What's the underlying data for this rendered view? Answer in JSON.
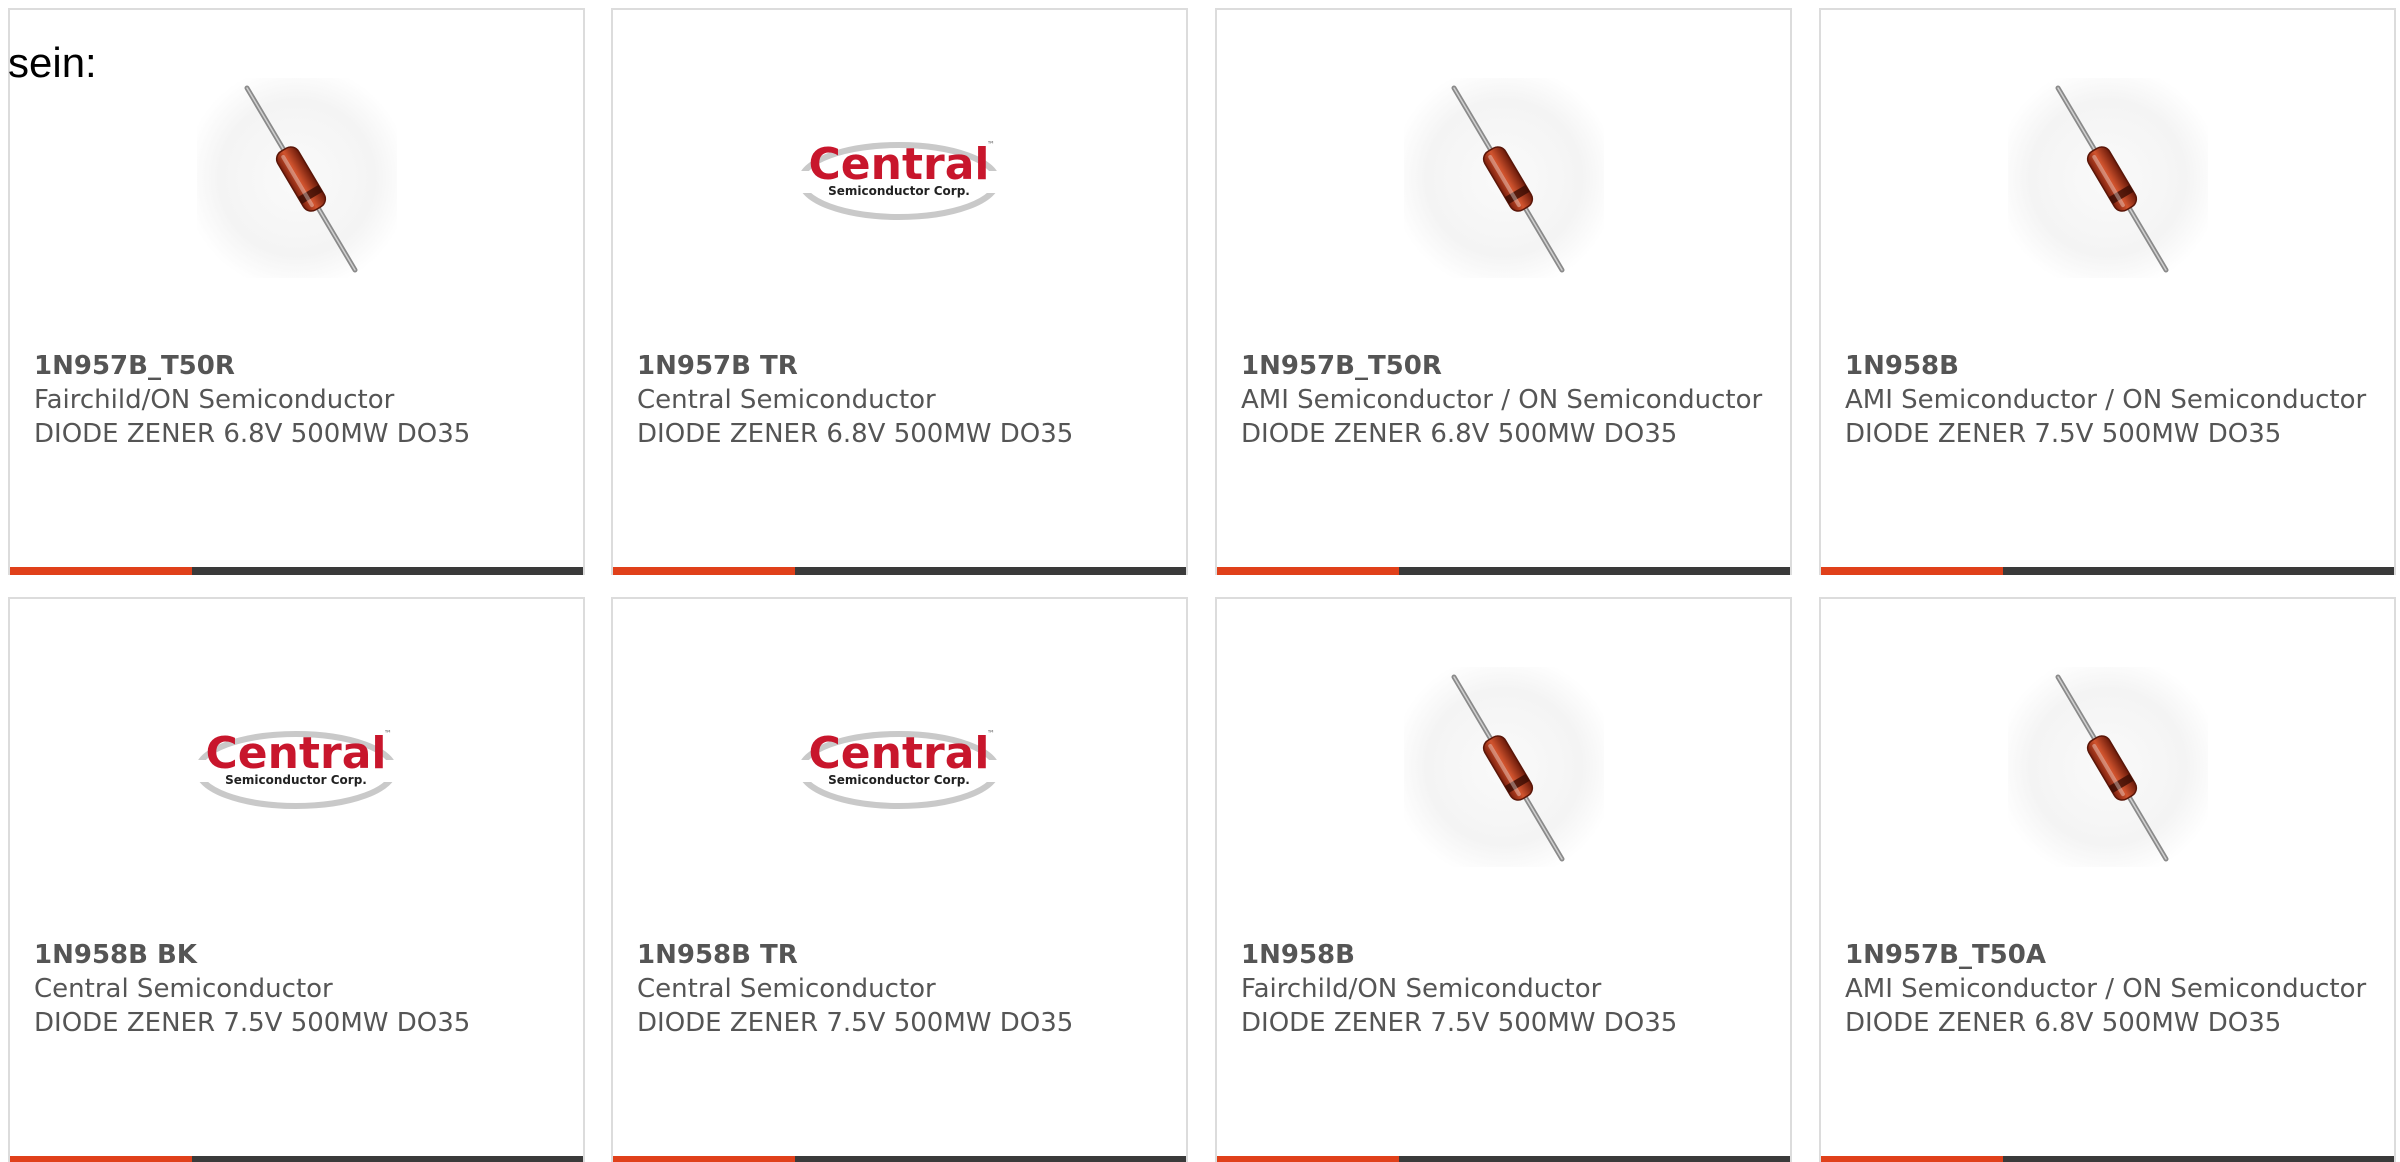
{
  "page": {
    "intro_text": "sein:"
  },
  "colors": {
    "accent": "#e0401a",
    "bar_dark": "#3a3a3a",
    "title_text": "#555555",
    "card_border": "#dcdcdc"
  },
  "products": [
    {
      "part": "1N957B_T50R",
      "maker": "Fairchild/ON Semiconductor",
      "desc": "DIODE ZENER 6.8V 500MW DO35",
      "image": "diode-icon"
    },
    {
      "part": "1N957B TR",
      "maker": "Central Semiconductor",
      "desc": "DIODE ZENER 6.8V 500MW DO35",
      "image": "central-logo-icon",
      "logo_word": "Central",
      "logo_sub": "Semiconductor Corp."
    },
    {
      "part": "1N957B_T50R",
      "maker": "AMI Semiconductor / ON Semiconductor",
      "desc": "DIODE ZENER 6.8V 500MW DO35",
      "image": "diode-icon"
    },
    {
      "part": "1N958B",
      "maker": "AMI Semiconductor / ON Semiconductor",
      "desc": "DIODE ZENER 7.5V 500MW DO35",
      "image": "diode-icon"
    },
    {
      "part": "1N958B BK",
      "maker": "Central Semiconductor",
      "desc": "DIODE ZENER 7.5V 500MW DO35",
      "image": "central-logo-icon",
      "logo_word": "Central",
      "logo_sub": "Semiconductor Corp."
    },
    {
      "part": "1N958B TR",
      "maker": "Central Semiconductor",
      "desc": "DIODE ZENER 7.5V 500MW DO35",
      "image": "central-logo-icon",
      "logo_word": "Central",
      "logo_sub": "Semiconductor Corp."
    },
    {
      "part": "1N958B",
      "maker": "Fairchild/ON Semiconductor",
      "desc": "DIODE ZENER 7.5V 500MW DO35",
      "image": "diode-icon"
    },
    {
      "part": "1N957B_T50A",
      "maker": "AMI Semiconductor / ON Semiconductor",
      "desc": "DIODE ZENER 6.8V 500MW DO35",
      "image": "diode-icon"
    }
  ]
}
